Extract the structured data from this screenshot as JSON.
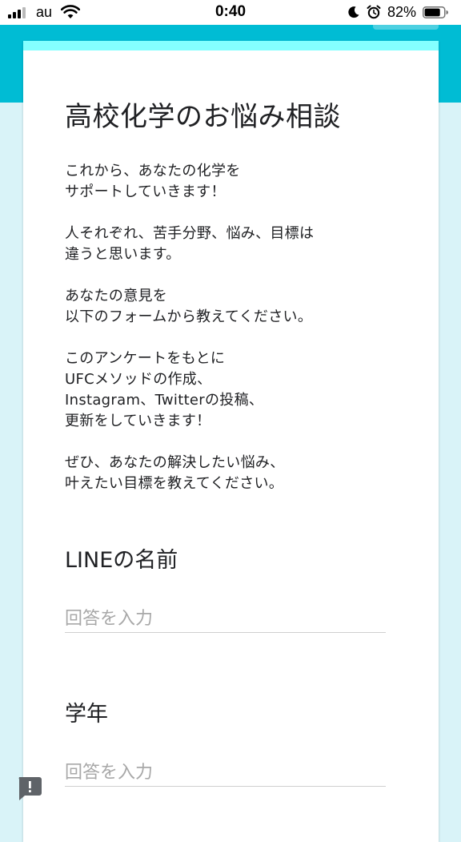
{
  "status_bar": {
    "carrier": "au",
    "time": "0:40",
    "battery_percent": "82%",
    "battery_level": 0.82,
    "signal_bars": 4,
    "signal_active": 3,
    "icons": [
      "signal-icon",
      "wifi-icon",
      "moon-icon",
      "alarm-icon",
      "battery-icon"
    ]
  },
  "theme": {
    "header_color": "#00bcd4",
    "accent_color": "#84ffff",
    "page_background": "#d9f3f8",
    "card_background": "#ffffff",
    "text_color": "#202124",
    "placeholder_color": "#a8a8a8"
  },
  "form": {
    "title": "高校化学のお悩み相談",
    "description": "これから、あなたの化学を\nサポートしていきます！\n\n人それぞれ、苦手分野、悩み、目標は\n違うと思います。\n\nあなたの意見を\n以下のフォームから教えてください。\n\nこのアンケートをもとに\nUFCメソッドの作成、\nInstagram、Twitterの投稿、\n更新をしていきます！\n\nぜひ、あなたの解決したい悩み、\n叶えたい目標を教えてください。"
  },
  "questions": [
    {
      "title": "LINEの名前",
      "placeholder": "回答を入力"
    },
    {
      "title": "学年",
      "placeholder": "回答を入力"
    }
  ],
  "feedback": {
    "icon": "feedback-icon"
  }
}
